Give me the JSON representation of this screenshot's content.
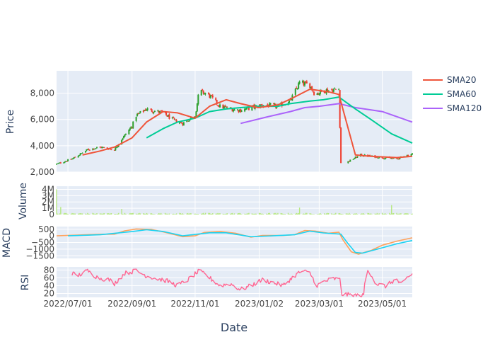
{
  "chart_data": {
    "type": "candlestick",
    "xlabel": "Date",
    "x_ticks": [
      "2022/07/01",
      "2022/09/01",
      "2022/11/01",
      "2023/01/02",
      "2023/03/01",
      "2023/05/01"
    ],
    "x_range": [
      "2022-06-20",
      "2023-05-30"
    ],
    "colors": {
      "plot_bg": "#e5ecf6",
      "grid": "#ffffff",
      "increasing": "#2ca02c",
      "decreasing": "#ef3b2c",
      "sma20": "#ef553b",
      "sma60": "#00cc96",
      "sma120": "#ab63fa",
      "volume": "#b6e880",
      "macd": "#ffa15a",
      "signal": "#19d3f3",
      "rsi": "#ff6692"
    },
    "panels": [
      {
        "id": "price",
        "ylabel": "Price",
        "ylim": [
          2000,
          9700
        ],
        "y_ticks": [
          2000,
          4000,
          6000,
          8000
        ],
        "y_tick_labels": [
          "2,000",
          "4,000",
          "6,000",
          "8,000"
        ],
        "legend": [
          {
            "name": "SMA20",
            "color": "#ef553b"
          },
          {
            "name": "SMA60",
            "color": "#00cc96"
          },
          {
            "name": "SMA120",
            "color": "#ab63fa"
          }
        ],
        "close_path": [
          [
            "2022-06-20",
            2600
          ],
          [
            "2022-07-05",
            3000
          ],
          [
            "2022-07-20",
            3700
          ],
          [
            "2022-08-01",
            3900
          ],
          [
            "2022-08-15",
            3700
          ],
          [
            "2022-08-22",
            4500
          ],
          [
            "2022-09-01",
            5500
          ],
          [
            "2022-09-05",
            6300
          ],
          [
            "2022-09-15",
            6800
          ],
          [
            "2022-09-25",
            6600
          ],
          [
            "2022-10-01",
            6500
          ],
          [
            "2022-10-12",
            5900
          ],
          [
            "2022-10-20",
            5700
          ],
          [
            "2022-11-01",
            6300
          ],
          [
            "2022-11-05",
            8200
          ],
          [
            "2022-11-15",
            7800
          ],
          [
            "2022-11-25",
            7000
          ],
          [
            "2022-12-05",
            6800
          ],
          [
            "2022-12-15",
            6700
          ],
          [
            "2022-12-25",
            6900
          ],
          [
            "2023-01-05",
            7100
          ],
          [
            "2023-01-20",
            7000
          ],
          [
            "2023-02-01",
            7400
          ],
          [
            "2023-02-10",
            8800
          ],
          [
            "2023-02-20",
            8600
          ],
          [
            "2023-02-25",
            7900
          ],
          [
            "2023-03-05",
            8200
          ],
          [
            "2023-03-20",
            8300
          ],
          [
            "2023-03-22",
            2700
          ],
          [
            "2023-03-29",
            2800
          ],
          [
            "2023-04-10",
            3300
          ],
          [
            "2023-04-20",
            3200
          ],
          [
            "2023-05-01",
            3100
          ],
          [
            "2023-05-15",
            3000
          ],
          [
            "2023-05-30",
            3400
          ]
        ],
        "sma20": [
          [
            "2022-07-15",
            3300
          ],
          [
            "2022-08-01",
            3600
          ],
          [
            "2022-08-15",
            3900
          ],
          [
            "2022-09-01",
            4600
          ],
          [
            "2022-09-15",
            5800
          ],
          [
            "2022-10-01",
            6600
          ],
          [
            "2022-10-15",
            6500
          ],
          [
            "2022-11-01",
            6100
          ],
          [
            "2022-11-15",
            7000
          ],
          [
            "2022-12-01",
            7500
          ],
          [
            "2022-12-15",
            7200
          ],
          [
            "2023-01-01",
            6900
          ],
          [
            "2023-01-20",
            7100
          ],
          [
            "2023-02-05",
            7700
          ],
          [
            "2023-02-20",
            8300
          ],
          [
            "2023-03-10",
            8100
          ],
          [
            "2023-03-20",
            7900
          ],
          [
            "2023-04-05",
            3300
          ],
          [
            "2023-04-20",
            3200
          ],
          [
            "2023-05-15",
            3100
          ],
          [
            "2023-05-30",
            3200
          ]
        ],
        "sma60": [
          [
            "2022-09-15",
            4600
          ],
          [
            "2022-10-01",
            5300
          ],
          [
            "2022-10-15",
            5800
          ],
          [
            "2022-11-01",
            6100
          ],
          [
            "2022-11-15",
            6600
          ],
          [
            "2022-12-01",
            6800
          ],
          [
            "2022-12-15",
            6900
          ],
          [
            "2023-01-01",
            7000
          ],
          [
            "2023-01-20",
            7000
          ],
          [
            "2023-02-01",
            7200
          ],
          [
            "2023-02-20",
            7400
          ],
          [
            "2023-03-05",
            7500
          ],
          [
            "2023-03-20",
            7700
          ],
          [
            "2023-04-05",
            6800
          ],
          [
            "2023-04-20",
            6000
          ],
          [
            "2023-05-10",
            4900
          ],
          [
            "2023-05-30",
            4200
          ]
        ],
        "sma120": [
          [
            "2022-12-15",
            5700
          ],
          [
            "2023-01-10",
            6200
          ],
          [
            "2023-02-01",
            6600
          ],
          [
            "2023-02-15",
            6900
          ],
          [
            "2023-03-01",
            7000
          ],
          [
            "2023-03-20",
            7200
          ],
          [
            "2023-04-05",
            6900
          ],
          [
            "2023-05-01",
            6600
          ],
          [
            "2023-05-30",
            5800
          ]
        ]
      },
      {
        "id": "volume",
        "ylabel": "Volume",
        "ylim": [
          0,
          4500000
        ],
        "y_ticks": [
          0,
          1000000,
          2000000,
          3000000,
          4000000
        ],
        "y_tick_labels": [
          "0",
          "1M",
          "2M",
          "3M",
          "4M"
        ],
        "spikes": [
          [
            "2022-06-20",
            4000000
          ],
          [
            "2022-06-24",
            1200000
          ],
          [
            "2022-07-02",
            800000
          ],
          [
            "2022-08-22",
            900000
          ],
          [
            "2022-11-05",
            1000000
          ],
          [
            "2023-02-10",
            1100000
          ],
          [
            "2023-04-15",
            800000
          ],
          [
            "2023-05-10",
            1500000
          ],
          [
            "2023-05-14",
            2300000
          ],
          [
            "2023-05-28",
            900000
          ]
        ]
      },
      {
        "id": "macd",
        "ylabel": "MACD",
        "ylim": [
          -1700,
          700
        ],
        "y_ticks": [
          -1500,
          -1000,
          -500,
          0,
          500
        ],
        "y_tick_labels": [
          "−1500",
          "−1000",
          "−500",
          "0",
          "500"
        ],
        "macd": [
          [
            "2022-06-20",
            0
          ],
          [
            "2022-07-10",
            60
          ],
          [
            "2022-08-01",
            120
          ],
          [
            "2022-08-15",
            130
          ],
          [
            "2022-08-25",
            380
          ],
          [
            "2022-09-05",
            520
          ],
          [
            "2022-09-20",
            480
          ],
          [
            "2022-10-01",
            300
          ],
          [
            "2022-10-20",
            -60
          ],
          [
            "2022-11-01",
            0
          ],
          [
            "2022-11-10",
            260
          ],
          [
            "2022-11-25",
            330
          ],
          [
            "2022-12-10",
            200
          ],
          [
            "2022-12-25",
            -100
          ],
          [
            "2023-01-05",
            30
          ],
          [
            "2023-01-25",
            30
          ],
          [
            "2023-02-05",
            80
          ],
          [
            "2023-02-15",
            400
          ],
          [
            "2023-02-25",
            360
          ],
          [
            "2023-03-10",
            200
          ],
          [
            "2023-03-20",
            280
          ],
          [
            "2023-03-24",
            -300
          ],
          [
            "2023-04-01",
            -1200
          ],
          [
            "2023-04-08",
            -1380
          ],
          [
            "2023-04-20",
            -1100
          ],
          [
            "2023-05-01",
            -700
          ],
          [
            "2023-05-15",
            -400
          ],
          [
            "2023-05-30",
            -150
          ]
        ],
        "signal": [
          [
            "2022-07-01",
            0
          ],
          [
            "2022-08-01",
            80
          ],
          [
            "2022-09-01",
            320
          ],
          [
            "2022-09-15",
            460
          ],
          [
            "2022-10-01",
            330
          ],
          [
            "2022-10-20",
            0
          ],
          [
            "2022-11-15",
            230
          ],
          [
            "2022-12-01",
            230
          ],
          [
            "2022-12-25",
            -60
          ],
          [
            "2023-01-15",
            0
          ],
          [
            "2023-02-05",
            80
          ],
          [
            "2023-02-20",
            360
          ],
          [
            "2023-03-05",
            220
          ],
          [
            "2023-03-22",
            130
          ],
          [
            "2023-03-28",
            -500
          ],
          [
            "2023-04-05",
            -1250
          ],
          [
            "2023-04-12",
            -1300
          ],
          [
            "2023-05-01",
            -900
          ],
          [
            "2023-05-15",
            -600
          ],
          [
            "2023-05-30",
            -350
          ]
        ]
      },
      {
        "id": "rsi",
        "ylabel": "RSI",
        "ylim": [
          10,
          88
        ],
        "y_ticks": [
          20,
          40,
          60,
          80
        ],
        "y_tick_labels": [
          "20",
          "40",
          "60",
          "80"
        ],
        "rsi": [
          [
            "2022-07-05",
            72
          ],
          [
            "2022-07-10",
            65
          ],
          [
            "2022-07-20",
            78
          ],
          [
            "2022-07-30",
            60
          ],
          [
            "2022-08-10",
            55
          ],
          [
            "2022-08-15",
            45
          ],
          [
            "2022-08-25",
            72
          ],
          [
            "2022-09-05",
            78
          ],
          [
            "2022-09-15",
            65
          ],
          [
            "2022-09-25",
            58
          ],
          [
            "2022-10-05",
            52
          ],
          [
            "2022-10-15",
            40
          ],
          [
            "2022-10-25",
            55
          ],
          [
            "2022-11-05",
            78
          ],
          [
            "2022-11-15",
            60
          ],
          [
            "2022-11-25",
            40
          ],
          [
            "2022-12-05",
            45
          ],
          [
            "2022-12-15",
            30
          ],
          [
            "2022-12-25",
            40
          ],
          [
            "2023-01-05",
            55
          ],
          [
            "2023-01-15",
            48
          ],
          [
            "2023-01-25",
            40
          ],
          [
            "2023-02-05",
            65
          ],
          [
            "2023-02-12",
            78
          ],
          [
            "2023-02-20",
            72
          ],
          [
            "2023-02-27",
            40
          ],
          [
            "2023-03-05",
            50
          ],
          [
            "2023-03-15",
            58
          ],
          [
            "2023-03-21",
            55
          ],
          [
            "2023-03-23",
            18
          ],
          [
            "2023-04-05",
            15
          ],
          [
            "2023-04-13",
            14
          ],
          [
            "2023-04-15",
            80
          ],
          [
            "2023-04-20",
            70
          ],
          [
            "2023-04-25",
            45
          ],
          [
            "2023-05-05",
            38
          ],
          [
            "2023-05-10",
            50
          ],
          [
            "2023-05-15",
            55
          ],
          [
            "2023-05-20",
            40
          ],
          [
            "2023-05-25",
            60
          ],
          [
            "2023-05-30",
            70
          ]
        ]
      }
    ]
  }
}
